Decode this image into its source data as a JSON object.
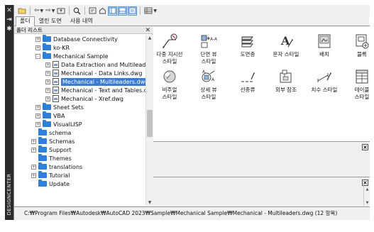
{
  "side": {
    "label": "DESIGNCENTER"
  },
  "tabs": [
    {
      "label": "폴더",
      "active": true
    },
    {
      "label": "열린 도면",
      "active": false
    },
    {
      "label": "사용 내역",
      "active": false
    }
  ],
  "tree": {
    "title": "폴더 리스트",
    "rows": [
      {
        "label": "Database Connectivity",
        "icon": "folder",
        "expander": "+"
      },
      {
        "label": "ko-KR",
        "icon": "folder",
        "expander": "+"
      },
      {
        "label": "Mechanical Sample",
        "icon": "folder",
        "expander": "-"
      },
      {
        "label": "Data Extraction and Multileaders",
        "icon": "drawing",
        "expander": "+"
      },
      {
        "label": "Mechanical - Data Links.dwg",
        "icon": "drawing",
        "expander": "+"
      },
      {
        "label": "Mechanical - Multileaders.dwg",
        "icon": "drawing",
        "expander": "+",
        "selected": true
      },
      {
        "label": "Mechanical - Text and Tables.dw",
        "icon": "drawing",
        "expander": "+"
      },
      {
        "label": "Mechanical - Xref.dwg",
        "icon": "drawing",
        "expander": "+"
      },
      {
        "label": "Sheet Sets",
        "icon": "folder",
        "expander": "+"
      },
      {
        "label": "VBA",
        "icon": "folder",
        "expander": "+"
      },
      {
        "label": "VisualLISP",
        "icon": "folder",
        "expander": "+"
      },
      {
        "label": "schema",
        "icon": "folder",
        "expander": ""
      },
      {
        "label": "Schemas",
        "icon": "folder",
        "expander": "+"
      },
      {
        "label": "Support",
        "icon": "folder",
        "expander": "+"
      },
      {
        "label": "Themes",
        "icon": "folder",
        "expander": ""
      },
      {
        "label": "translations",
        "icon": "folder",
        "expander": "+"
      },
      {
        "label": "Tutorial",
        "icon": "folder",
        "expander": "+"
      },
      {
        "label": "Update",
        "icon": "folder",
        "expander": ""
      }
    ]
  },
  "content_items": [
    {
      "line1": "다중 지시선",
      "line2": "스타일",
      "icon": "multileader-style-icon"
    },
    {
      "line1": "단면 뷰",
      "line2": "스타일",
      "icon": "section-view-style-icon"
    },
    {
      "line1": "도면층",
      "line2": "",
      "icon": "layers-icon"
    },
    {
      "line1": "문자 스타일",
      "line2": "",
      "icon": "text-style-icon"
    },
    {
      "line1": "배치",
      "line2": "",
      "icon": "layout-icon"
    },
    {
      "line1": "블록",
      "line2": "",
      "icon": "block-icon"
    },
    {
      "line1": "비주얼",
      "line2": "스타일",
      "icon": "visual-style-icon"
    },
    {
      "line1": "상세 뷰",
      "line2": "스타일",
      "icon": "detail-view-style-icon"
    },
    {
      "line1": "선종류",
      "line2": "",
      "icon": "linetype-icon"
    },
    {
      "line1": "외부 참조",
      "line2": "",
      "icon": "xref-icon"
    },
    {
      "line1": "치수 스타일",
      "line2": "",
      "icon": "dimension-style-icon"
    },
    {
      "line1": "테이블",
      "line2": "스타일",
      "icon": "table-style-icon"
    }
  ],
  "status": {
    "path": "C:₩Program Files₩Autodesk₩AutoCAD 2023₩Sample₩Mechanical Sample₩Mechanical - Multileaders.dwg (12 항목)"
  }
}
